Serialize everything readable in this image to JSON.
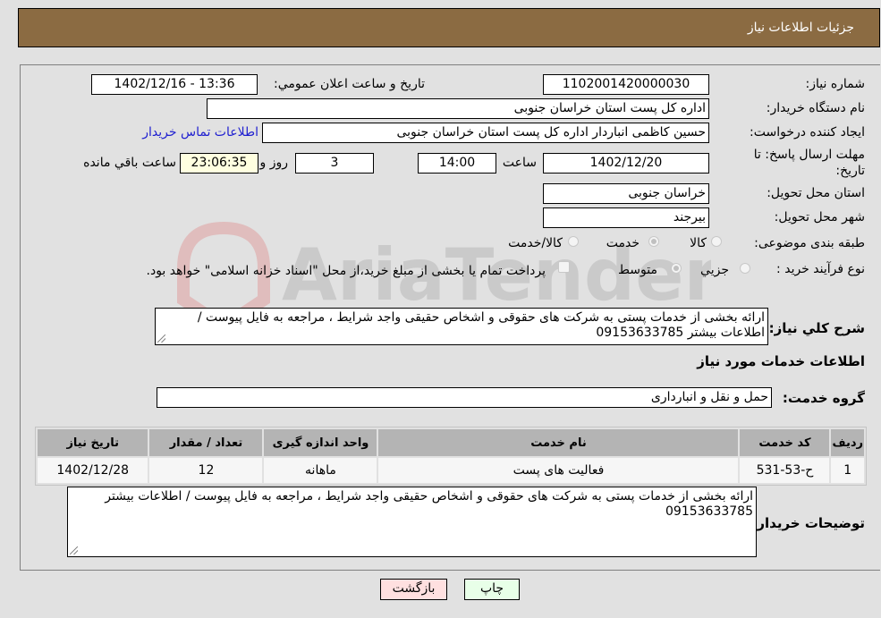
{
  "header": {
    "title": "جزئیات اطلاعات نیاز"
  },
  "fields": {
    "need_number_label": "شماره نیاز:",
    "need_number": "1102001420000030",
    "announce_label": "تاریخ و ساعت اعلان عمومي:",
    "announce_value": "1402/12/16 - 13:36",
    "buyer_org_label": "نام دستگاه خریدار:",
    "buyer_org": "اداره کل پست استان خراسان جنوبی",
    "creator_label": "ایجاد کننده درخواست:",
    "creator": "حسین کاظمی انباردار اداره کل پست استان خراسان جنوبی",
    "contact_link": "اطلاعات تماس خریدار",
    "deadline_label": "مهلت ارسال پاسخ: تا تاریخ:",
    "deadline_date": "1402/12/20",
    "time_label": "ساعت",
    "deadline_time": "14:00",
    "days_value": "3",
    "days_label": "روز و",
    "remaining_time": "23:06:35",
    "remaining_label": "ساعت باقي مانده",
    "province_label": "استان محل تحویل:",
    "province": "خراسان جنوبی",
    "city_label": "شهر محل تحویل:",
    "city": "بیرجند",
    "category_label": "طبقه بندی موضوعی:",
    "category_options": [
      "کالا",
      "خدمت",
      "کالا/خدمت"
    ],
    "category_selected": "خدمت",
    "process_label": "نوع فرآیند خرید :",
    "process_options": [
      "جزيي",
      "متوسط"
    ],
    "process_selected": "متوسط",
    "treasury_note": "پرداخت تمام یا بخشی از مبلغ خرید،از محل \"اسناد خزانه اسلامی\" خواهد بود."
  },
  "description": {
    "label": "شرح کلي نياز:",
    "text": "ارائه بخشی از خدمات پستی به شرکت های حقوقی و اشخاص حقیقی واجد شرایط ، مراجعه به فایل پیوست / اطلاعات بیشتر 09153633785"
  },
  "services": {
    "section_title": "اطلاعات خدمات مورد نیاز",
    "group_label": "گروه خدمت:",
    "group_value": "حمل و نقل و انبارداری",
    "columns": [
      "ردیف",
      "کد خدمت",
      "نام خدمت",
      "واحد اندازه گیری",
      "تعداد / مقدار",
      "تاریخ نیاز"
    ],
    "rows": [
      [
        "1",
        "ح-53-531",
        "فعالیت های پست",
        "ماهانه",
        "12",
        "1402/12/28"
      ]
    ]
  },
  "buyer_notes": {
    "label": "توضیحات خریدار:",
    "text": "ارائه بخشی از خدمات پستی به شرکت های حقوقی و اشخاص حقیقی واجد شرایط ، مراجعه به فایل پیوست / اطلاعات بیشتر 09153633785"
  },
  "buttons": {
    "print": "چاپ",
    "back": "بازگشت"
  },
  "watermark": {
    "text": "AriaTender.neT"
  },
  "colors": {
    "header_bg": "#8b6b42",
    "back_btn": "#ffe0e0",
    "print_btn": "#e8ffe8",
    "link": "#2020d0"
  }
}
